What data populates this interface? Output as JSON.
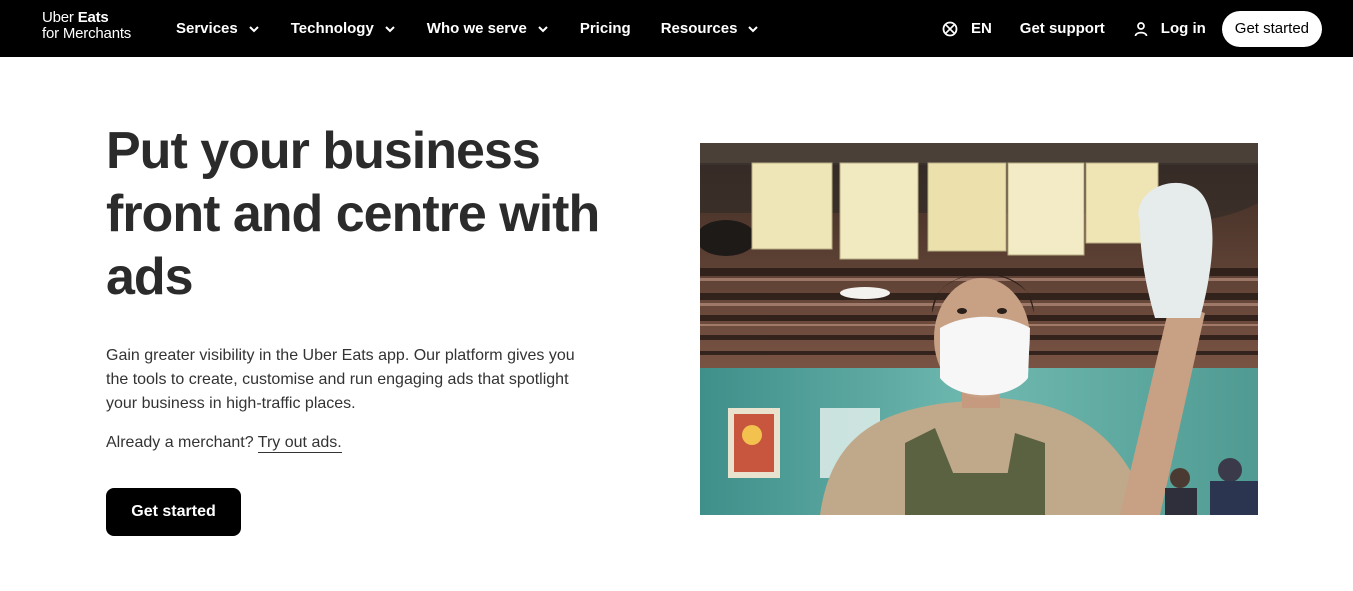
{
  "header": {
    "logo": {
      "line1_a": "Uber ",
      "line1_b": "Eats",
      "line2": "for Merchants"
    },
    "nav": [
      {
        "label": "Services",
        "has_dropdown": true
      },
      {
        "label": "Technology",
        "has_dropdown": true
      },
      {
        "label": "Who we serve",
        "has_dropdown": true
      },
      {
        "label": "Pricing",
        "has_dropdown": false
      },
      {
        "label": "Resources",
        "has_dropdown": true
      }
    ],
    "language": {
      "icon": "globe-icon",
      "label": "EN"
    },
    "support_label": "Get support",
    "login": {
      "icon": "person-icon",
      "label": "Log in"
    },
    "cta_label": "Get started"
  },
  "hero": {
    "title": "Put your business front and centre with ads",
    "body": "Gain greater visibility in the Uber Eats app. Our platform gives you the tools to create, customise and run engaging ads that spotlight your business in high-traffic places.",
    "merchant_prefix": "Already a merchant? ",
    "merchant_link": "Try out ads.",
    "cta_label": "Get started"
  },
  "colors": {
    "header_bg": "#000000",
    "header_text": "#ffffff",
    "title_text": "#2b2b2b",
    "body_text": "#333333",
    "cta_bg": "#000000"
  }
}
